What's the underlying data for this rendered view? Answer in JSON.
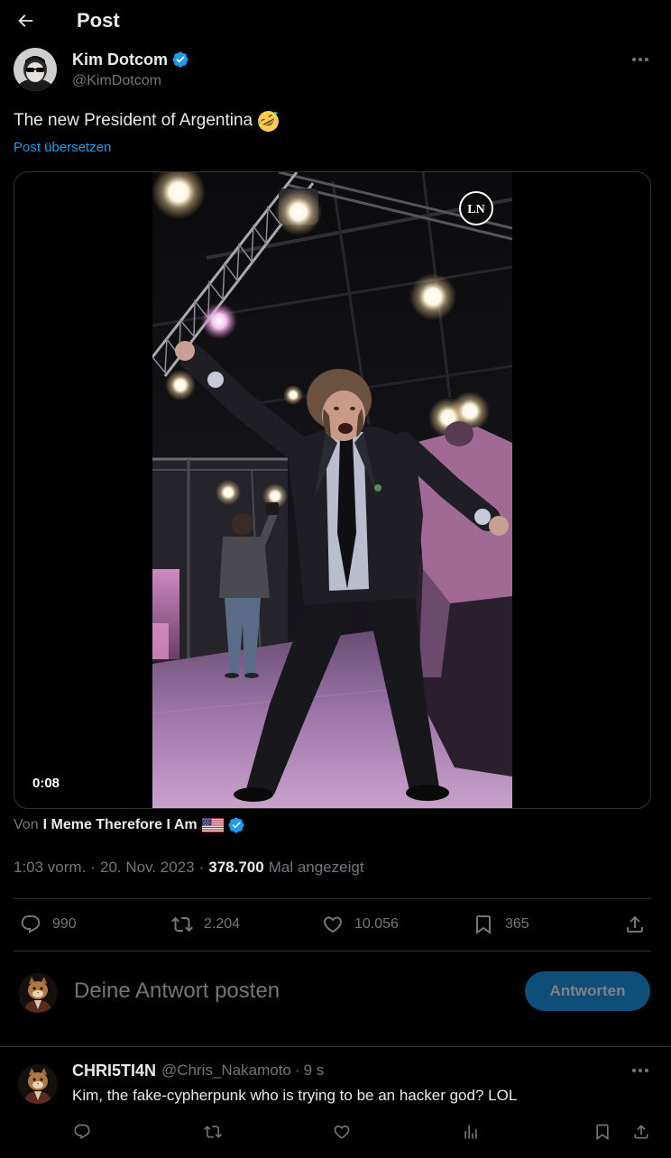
{
  "header": {
    "title": "Post",
    "back_icon": "arrow-left-icon"
  },
  "post": {
    "author": {
      "name": "Kim Dotcom",
      "handle": "@KimDotcom",
      "verified_icon": "verified-badge-icon",
      "more_icon": "more-icon"
    },
    "text": "The new President of Argentina",
    "emoji_icon": "rolling-on-the-floor-laughing-emoji-icon",
    "translate_label": "Post übersetzen",
    "media": {
      "duration": "0:08",
      "watermark": "LN"
    },
    "attribution": {
      "prefix": "Von",
      "name": "I Meme Therefore I Am",
      "flag_icon": "us-flag-icon",
      "verified_icon": "verified-badge-icon"
    },
    "meta": {
      "time": "1:03 vorm.",
      "separator": "·",
      "date": "20. Nov. 2023",
      "views": "378.700",
      "views_label": "Mal angezeigt"
    },
    "stats": {
      "replies": "990",
      "reposts": "2.204",
      "likes": "10.056",
      "bookmarks": "365"
    },
    "action_icons": [
      "reply-icon",
      "repost-icon",
      "like-icon",
      "bookmark-icon",
      "share-icon"
    ]
  },
  "composer": {
    "placeholder": "Deine Antwort posten",
    "button_label": "Antworten",
    "button_enabled": false
  },
  "replies": [
    {
      "name": "CHRI5TI4N",
      "handle": "@Chris_Nakamoto",
      "separator": "·",
      "time": "9 s",
      "text": "Kim, the fake-cypherpunk who is trying to be an hacker god? LOL",
      "action_icons": [
        "reply-icon",
        "repost-icon",
        "like-icon",
        "views-icon",
        "bookmark-icon",
        "share-icon"
      ]
    }
  ],
  "theme": {
    "background": "#000000",
    "text": "#e7e9ea",
    "secondary_text": "#71767b",
    "accent": "#1d9bf0",
    "border": "#2f3336"
  }
}
